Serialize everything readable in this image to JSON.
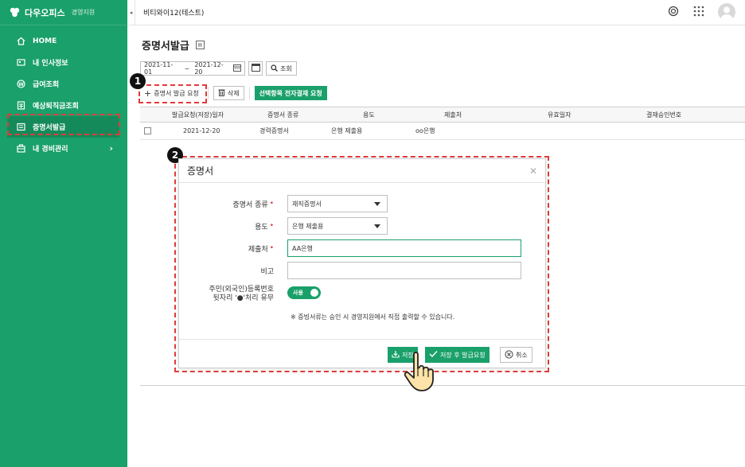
{
  "app": {
    "name": "다우오피스",
    "module": "경영지원"
  },
  "sidebar": {
    "items": [
      {
        "label": "HOME",
        "icon": "home-icon"
      },
      {
        "label": "내 인사정보",
        "icon": "id-card-icon"
      },
      {
        "label": "급여조회",
        "icon": "coin-icon"
      },
      {
        "label": "예상퇴직금조회",
        "icon": "calculator-icon"
      },
      {
        "label": "증명서발급",
        "icon": "certificate-icon"
      },
      {
        "label": "내 경비관리",
        "icon": "briefcase-icon"
      }
    ],
    "active_index": 4
  },
  "header": {
    "company": "비티와이12(테스트)"
  },
  "page": {
    "title": "증명서발급"
  },
  "filter": {
    "date_from": "2021-11-01",
    "date_to": "2021-12-20",
    "separator": "~",
    "search_label": "조회"
  },
  "actions": {
    "request": "증명서 발급 요청",
    "delete": "삭제",
    "approve": "선택항목 전자결재 요청"
  },
  "table": {
    "columns": [
      "발급요청(저장)일자",
      "증명서 종류",
      "용도",
      "제출처",
      "유효일자",
      "결재승인번호"
    ],
    "rows": [
      [
        "2021-12-20",
        "경력증명서",
        "은행 제출용",
        "oo은행",
        "",
        ""
      ]
    ]
  },
  "modal": {
    "title": "증명서",
    "fields": {
      "cert_type": {
        "label": "증명서 종류",
        "value": "재직증명서"
      },
      "purpose": {
        "label": "용도",
        "value": "은행 제출용"
      },
      "submit_to": {
        "label": "제출처",
        "value": "AA은행"
      },
      "note": {
        "label": "비고",
        "value": ""
      },
      "rrn_mask": {
        "label_line1": "주민(외국인)등록번호",
        "label_line2": "뒷자리 '●'처리 유무",
        "toggle_label": "사용"
      }
    },
    "notice": "※ 증빙서류는 승인 시 경영지원에서 직접 출력할 수 있습니다.",
    "buttons": {
      "save": "저장",
      "save_request": "저장 후 발급요청",
      "cancel": "취소"
    }
  },
  "annotations": {
    "badge1": "1",
    "badge2": "2"
  },
  "colors": {
    "accent": "#1aa06a",
    "highlight": "#e23a3a"
  }
}
